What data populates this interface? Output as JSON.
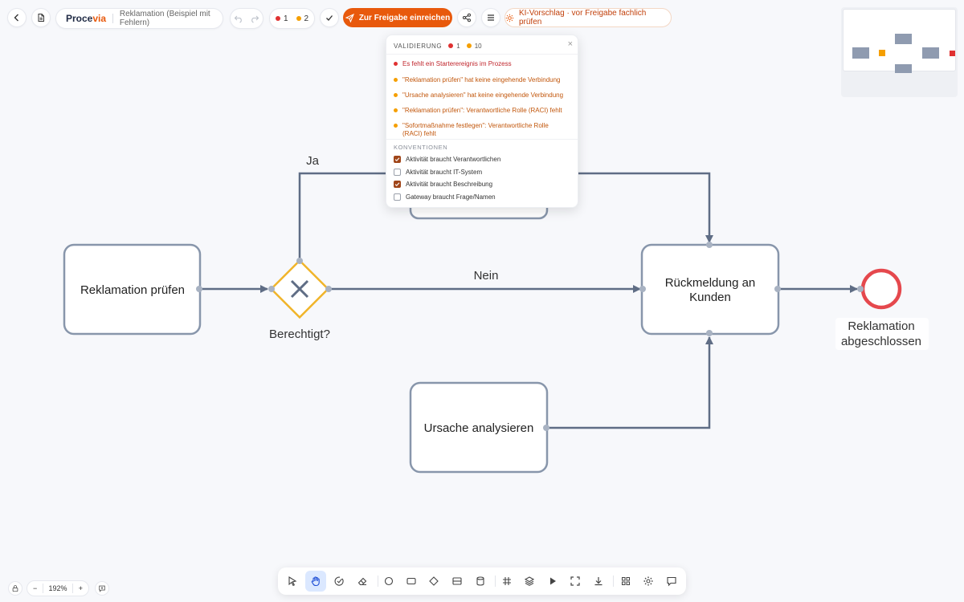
{
  "header": {
    "brand_main": "Proce",
    "brand_accent": "via",
    "doc_title": "Reklamation (Beispiel mit Fehlern)",
    "error_count": "1",
    "warning_count": "2",
    "submit_label": "Zur Freigabe einreichen",
    "ki_label": "KI-Vorschlag · vor Freigabe fachlich prüfen"
  },
  "colors": {
    "accent": "#e8590c",
    "error": "#e03131",
    "warning": "#f59f00",
    "node_stroke": "#8896ab",
    "edge": "#5f6d85",
    "gateway": "#f0b429",
    "end_event": "#e5484d"
  },
  "validation": {
    "title": "VALIDIERUNG",
    "error_count": "1",
    "warning_count": "10",
    "close": "×",
    "issues": [
      {
        "level": "error",
        "text": "Es fehlt ein Starterereignis im Prozess"
      },
      {
        "level": "warning",
        "text": "\"Reklamation prüfen\" hat keine eingehende Verbindung"
      },
      {
        "level": "warning",
        "text": "\"Ursache analysieren\" hat keine eingehende Verbindung"
      },
      {
        "level": "warning",
        "text": "\"Reklamation prüfen\": Verantwortliche Rolle (RACI) fehlt"
      },
      {
        "level": "warning",
        "text": "\"Sofortmaßnahme festlegen\": Verantwortliche Rolle (RACI) fehlt"
      }
    ],
    "conventions_title": "KONVENTIONEN",
    "conventions": [
      {
        "label": "Aktivität braucht Verantwortlichen",
        "checked": true
      },
      {
        "label": "Aktivität braucht IT-System",
        "checked": false
      },
      {
        "label": "Aktivität braucht Beschreibung",
        "checked": true
      },
      {
        "label": "Gateway braucht Frage/Namen",
        "checked": false
      }
    ]
  },
  "diagram": {
    "task_review": "Reklamation prüfen",
    "gateway_label": "Berechtigt?",
    "edge_yes": "Ja",
    "edge_no": "Nein",
    "task_feedback_line1": "Rückmeldung an",
    "task_feedback_line2": "Kunden",
    "end_label_line1": "Reklamation",
    "end_label_line2": "abgeschlossen",
    "task_cause": "Ursache analysieren"
  },
  "zoom": {
    "minus": "−",
    "level": "192%",
    "plus": "+"
  },
  "toolbar": {
    "icons": [
      "pointer-icon",
      "hand-icon",
      "magic-icon",
      "eraser-icon",
      "circle-icon",
      "rectangle-icon",
      "diamond-icon",
      "lane-icon",
      "database-icon",
      "grid-icon",
      "layers-icon",
      "play-icon",
      "fit-icon",
      "download-icon",
      "apps-icon",
      "settings-icon",
      "comment-icon"
    ]
  }
}
